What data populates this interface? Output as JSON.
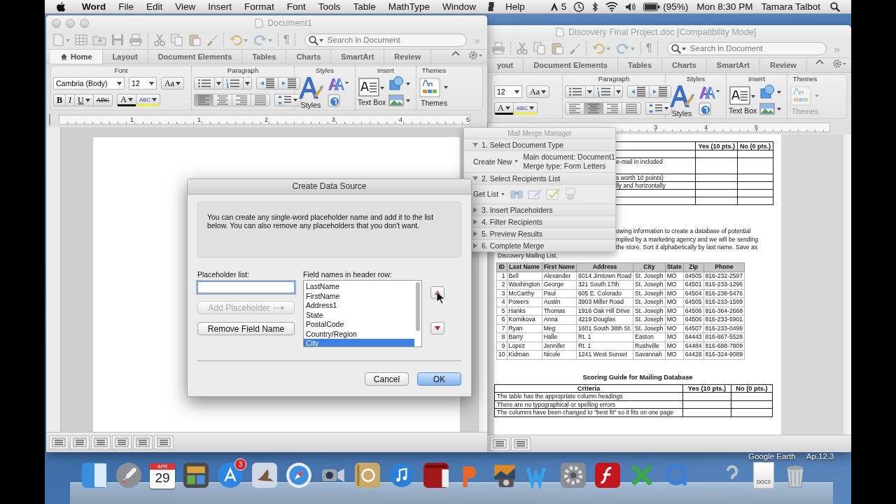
{
  "menu_bar": {
    "app": "Word",
    "items": [
      "File",
      "Edit",
      "View",
      "Insert",
      "Format",
      "Font",
      "Tools",
      "Table",
      "MathType",
      "Window"
    ],
    "help": "Help",
    "status_count": "5",
    "battery": "(95%)",
    "clock": "Mon 8:30 PM",
    "user": "Tamara Talbot"
  },
  "windows": [
    {
      "title": "Document1",
      "search_placeholder": "Search in Document",
      "overflow": "»",
      "pilcrow": "¶",
      "tabs": [
        {
          "label": "Home",
          "selected": true
        },
        {
          "label": "Layout",
          "selected": false
        },
        {
          "label": "Document Elements",
          "selected": false
        },
        {
          "label": "Tables",
          "selected": false
        },
        {
          "label": "Charts",
          "selected": false
        },
        {
          "label": "SmartArt",
          "selected": false
        },
        {
          "label": "Review",
          "selected": false
        }
      ],
      "ribbon": {
        "font_label": "Font",
        "font_name": "Cambria (Body)",
        "font_size": "12",
        "change_case": "Aa",
        "bold": "B",
        "italic": "I",
        "underline": "U",
        "strike": "ABC",
        "font_color": "A",
        "highlight": "ABC",
        "paragraph_label": "Paragraph",
        "styles_label": "Styles",
        "styles": "Styles",
        "insert_label": "Insert",
        "text_box": "Text Box",
        "themes_label": "Themes",
        "themes": "Themes",
        "themes_disabled": false,
        "align": [
          {
            "selected": true
          },
          {
            "selected": false
          },
          {
            "selected": false
          },
          {
            "selected": false
          }
        ]
      },
      "ruler": [
        "1",
        "1",
        "2",
        "3",
        "4",
        "5"
      ]
    },
    {
      "title": "Discovery Final Project.doc [Compatibility Mode]",
      "search_placeholder": "Search in Document",
      "overflow": "»",
      "pilcrow": "¶",
      "tabs": [
        {
          "label": "yout",
          "selected": false
        },
        {
          "label": "Document Elements",
          "selected": false
        },
        {
          "label": "Tables",
          "selected": false
        },
        {
          "label": "Charts",
          "selected": false
        },
        {
          "label": "SmartArt",
          "selected": false
        },
        {
          "label": "Review",
          "selected": false
        }
      ],
      "ribbon": {
        "font_size": "12",
        "change_case": "Aa",
        "font_color": "A",
        "highlight": "ABC",
        "paragraph_label": "Paragraph",
        "styles_label": "Styles",
        "styles": "Styles",
        "insert_label": "Insert",
        "text_box": "Text Box",
        "themes_label": "Themes",
        "themes": "Themes",
        "themes_disabled": true,
        "align": [
          {
            "selected": false
          },
          {
            "selected": true
          },
          {
            "selected": false
          },
          {
            "selected": false
          }
        ]
      },
      "ruler": [
        "3",
        "4",
        "5"
      ],
      "document": {
        "top_table": {
          "columns": [
            "Yes (10 pts.)",
            "No (0 pts.)"
          ],
          "rows": [
            {
              "kind": "short"
            },
            {
              "kind": "tall",
              "text": "e-mail in included"
            },
            {
              "kind": "short",
              "text": "s worth 10 points)"
            },
            {
              "kind": "short",
              "text": "lly and horizontally"
            },
            {
              "kind": "short"
            },
            {
              "kind": "short"
            }
          ]
        },
        "paragraph": [
          {
            "kind": "cut",
            "text": "owing information to create a database of potential"
          },
          {
            "kind": "cut",
            "text": "mpiled by a marketing agency and we will be sending"
          },
          {
            "kind": "cut",
            "text": "the store.  Sort it alphabetically by last name.  Save as"
          },
          {
            "kind": "full",
            "text": "Discovery Mailing List."
          }
        ],
        "mailing_table": {
          "columns": [
            "ID",
            "Last Name",
            "First Name",
            "Address",
            "City",
            "State",
            "Zip",
            "Phone"
          ],
          "rows": [
            [
              "1",
              "Bell",
              "Alexander",
              "6014 Jimtown Road",
              "St. Joseph",
              "MO",
              "64505",
              "816-232-2597"
            ],
            [
              "2",
              "Washington",
              "George",
              "321 South 17th",
              "St. Joseph",
              "MO",
              "64501",
              "816-233-1296"
            ],
            [
              "3",
              "McCarthy",
              "Paul",
              "605 E. Colorado",
              "St. Joseph",
              "MO",
              "64504",
              "816-238-5476"
            ],
            [
              "4",
              "Powers",
              "Austin",
              "3903 Miller Road",
              "St. Joseph",
              "MO",
              "64505",
              "816-233-1599"
            ],
            [
              "5",
              "Hanks",
              "Thomas",
              "1916 Oak Hill Drive",
              "St. Joseph",
              "MO",
              "64506",
              "816-364-2668"
            ],
            [
              "6",
              "Kornikova",
              "Anna",
              "4219 Douglas",
              "St. Joseph",
              "MO",
              "64506",
              "816-233-5901"
            ],
            [
              "7",
              "Ryan",
              "Meg",
              "1601 South 38th St.",
              "St. Joseph",
              "MO",
              "64507",
              "816-233-0499"
            ],
            [
              "8",
              "Barry",
              "Halle",
              "Rt. 1",
              "Easton",
              "MO",
              "64443",
              "816-667-5528"
            ],
            [
              "9",
              "Lopez",
              "Jennifer",
              "Rt. 1",
              "Rushville",
              "MO",
              "64484",
              "816-688-7809"
            ],
            [
              "10",
              "Kidman",
              "Nicole",
              "1241 West Sunset",
              "Savannah",
              "MO",
              "64428",
              "816-324-9089"
            ]
          ]
        },
        "scoring_title": "Scoring Guide for Mailing Database",
        "scoring_table": {
          "columns": [
            "Criteria",
            "Yes (10 pts.)",
            "No (0 pts.)"
          ],
          "rows": [
            "The table has the appropriate column headings",
            "There are no typographical or spelling errors",
            "The columns have been changed to \"best fit\" so it fits on one page"
          ]
        }
      }
    }
  ],
  "mail_merge": {
    "title": "Mail Merge Manager",
    "steps": [
      {
        "label": "1. Select Document Type",
        "expanded": true,
        "action": "Create New",
        "details": [
          "Main document: Document1",
          "Merge type: Form Letters"
        ]
      },
      {
        "label": "2. Select Recipients List",
        "expanded": true,
        "action": "Get List"
      },
      {
        "label": "3. Insert Placeholders",
        "expanded": false
      },
      {
        "label": "4. Filter Recipients",
        "expanded": false
      },
      {
        "label": "5. Preview Results",
        "expanded": false
      },
      {
        "label": "6. Complete Merge",
        "expanded": false
      }
    ]
  },
  "dialog": {
    "title": "Create Data Source",
    "message": "You can create any single-word placeholder name and add it to the list below.  You can also remove any placeholders that you don't want.",
    "placeholder_label": "Placeholder list:",
    "placeholder_focused": true,
    "add_button": {
      "label": "Add Placeholder",
      "disabled": true
    },
    "remove_button": {
      "label": "Remove Field Name",
      "disabled": false
    },
    "fields_label": "Field names in header row:",
    "fields": [
      {
        "label": "LastName",
        "selected": false
      },
      {
        "label": "FirstName",
        "selected": false
      },
      {
        "label": "Address1",
        "selected": false
      },
      {
        "label": "State",
        "selected": false
      },
      {
        "label": "PostalCode",
        "selected": false
      },
      {
        "label": "Country/Region",
        "selected": false
      },
      {
        "label": "City",
        "selected": true
      }
    ],
    "buttons": [
      {
        "label": "Cancel",
        "default": false
      },
      {
        "label": "OK",
        "default": true
      }
    ]
  },
  "dock": {
    "calendar_month": "APR",
    "calendar_day": "29",
    "store_badge": "3",
    "file_label": "DOCX"
  },
  "desktop": {
    "labels": [
      "Google Earth",
      "Ap.12.3"
    ]
  }
}
